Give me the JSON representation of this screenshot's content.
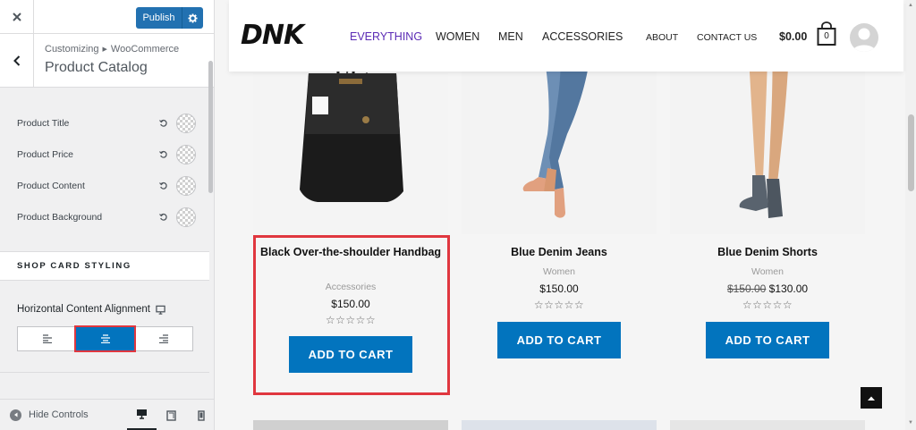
{
  "customizer": {
    "close_icon": "close-icon",
    "publish_label": "Publish",
    "breadcrumb_root": "Customizing",
    "breadcrumb_section": "WooCommerce",
    "section_title": "Product Catalog",
    "color_controls": [
      {
        "label": "Product Title"
      },
      {
        "label": "Product Price"
      },
      {
        "label": "Product Content"
      },
      {
        "label": "Product Background"
      }
    ],
    "shop_card_heading": "SHOP CARD STYLING",
    "alignment_label": "Horizontal Content Alignment",
    "alignment_options": [
      "left",
      "center",
      "right"
    ],
    "alignment_selected": "center",
    "hide_controls_label": "Hide Controls",
    "device_modes": [
      "desktop",
      "tablet",
      "mobile"
    ],
    "device_selected": "desktop",
    "accent_color": "#0274be",
    "highlight_color": "#e0373f"
  },
  "site": {
    "logo": "DNK",
    "nav_primary": [
      "EVERYTHING",
      "WOMEN",
      "MEN",
      "ACCESSORIES"
    ],
    "nav_active": "EVERYTHING",
    "nav_secondary": [
      "ABOUT",
      "CONTACT US"
    ],
    "cart_total": "$0.00",
    "cart_count": "0",
    "brand_color": "#5b2bb5"
  },
  "products": [
    {
      "title": "Black Over-the-shoulder Handbag",
      "category": "Accessories",
      "price": "$150.00",
      "old_price": "",
      "rating": "☆☆☆☆☆",
      "button": "ADD TO CART"
    },
    {
      "title": "Blue Denim Jeans",
      "category": "Women",
      "price": "$150.00",
      "old_price": "",
      "rating": "☆☆☆☆☆",
      "button": "ADD TO CART"
    },
    {
      "title": "Blue Denim Shorts",
      "category": "Women",
      "price": "$130.00",
      "old_price": "$150.00",
      "rating": "☆☆☆☆☆",
      "button": "ADD TO CART"
    }
  ]
}
